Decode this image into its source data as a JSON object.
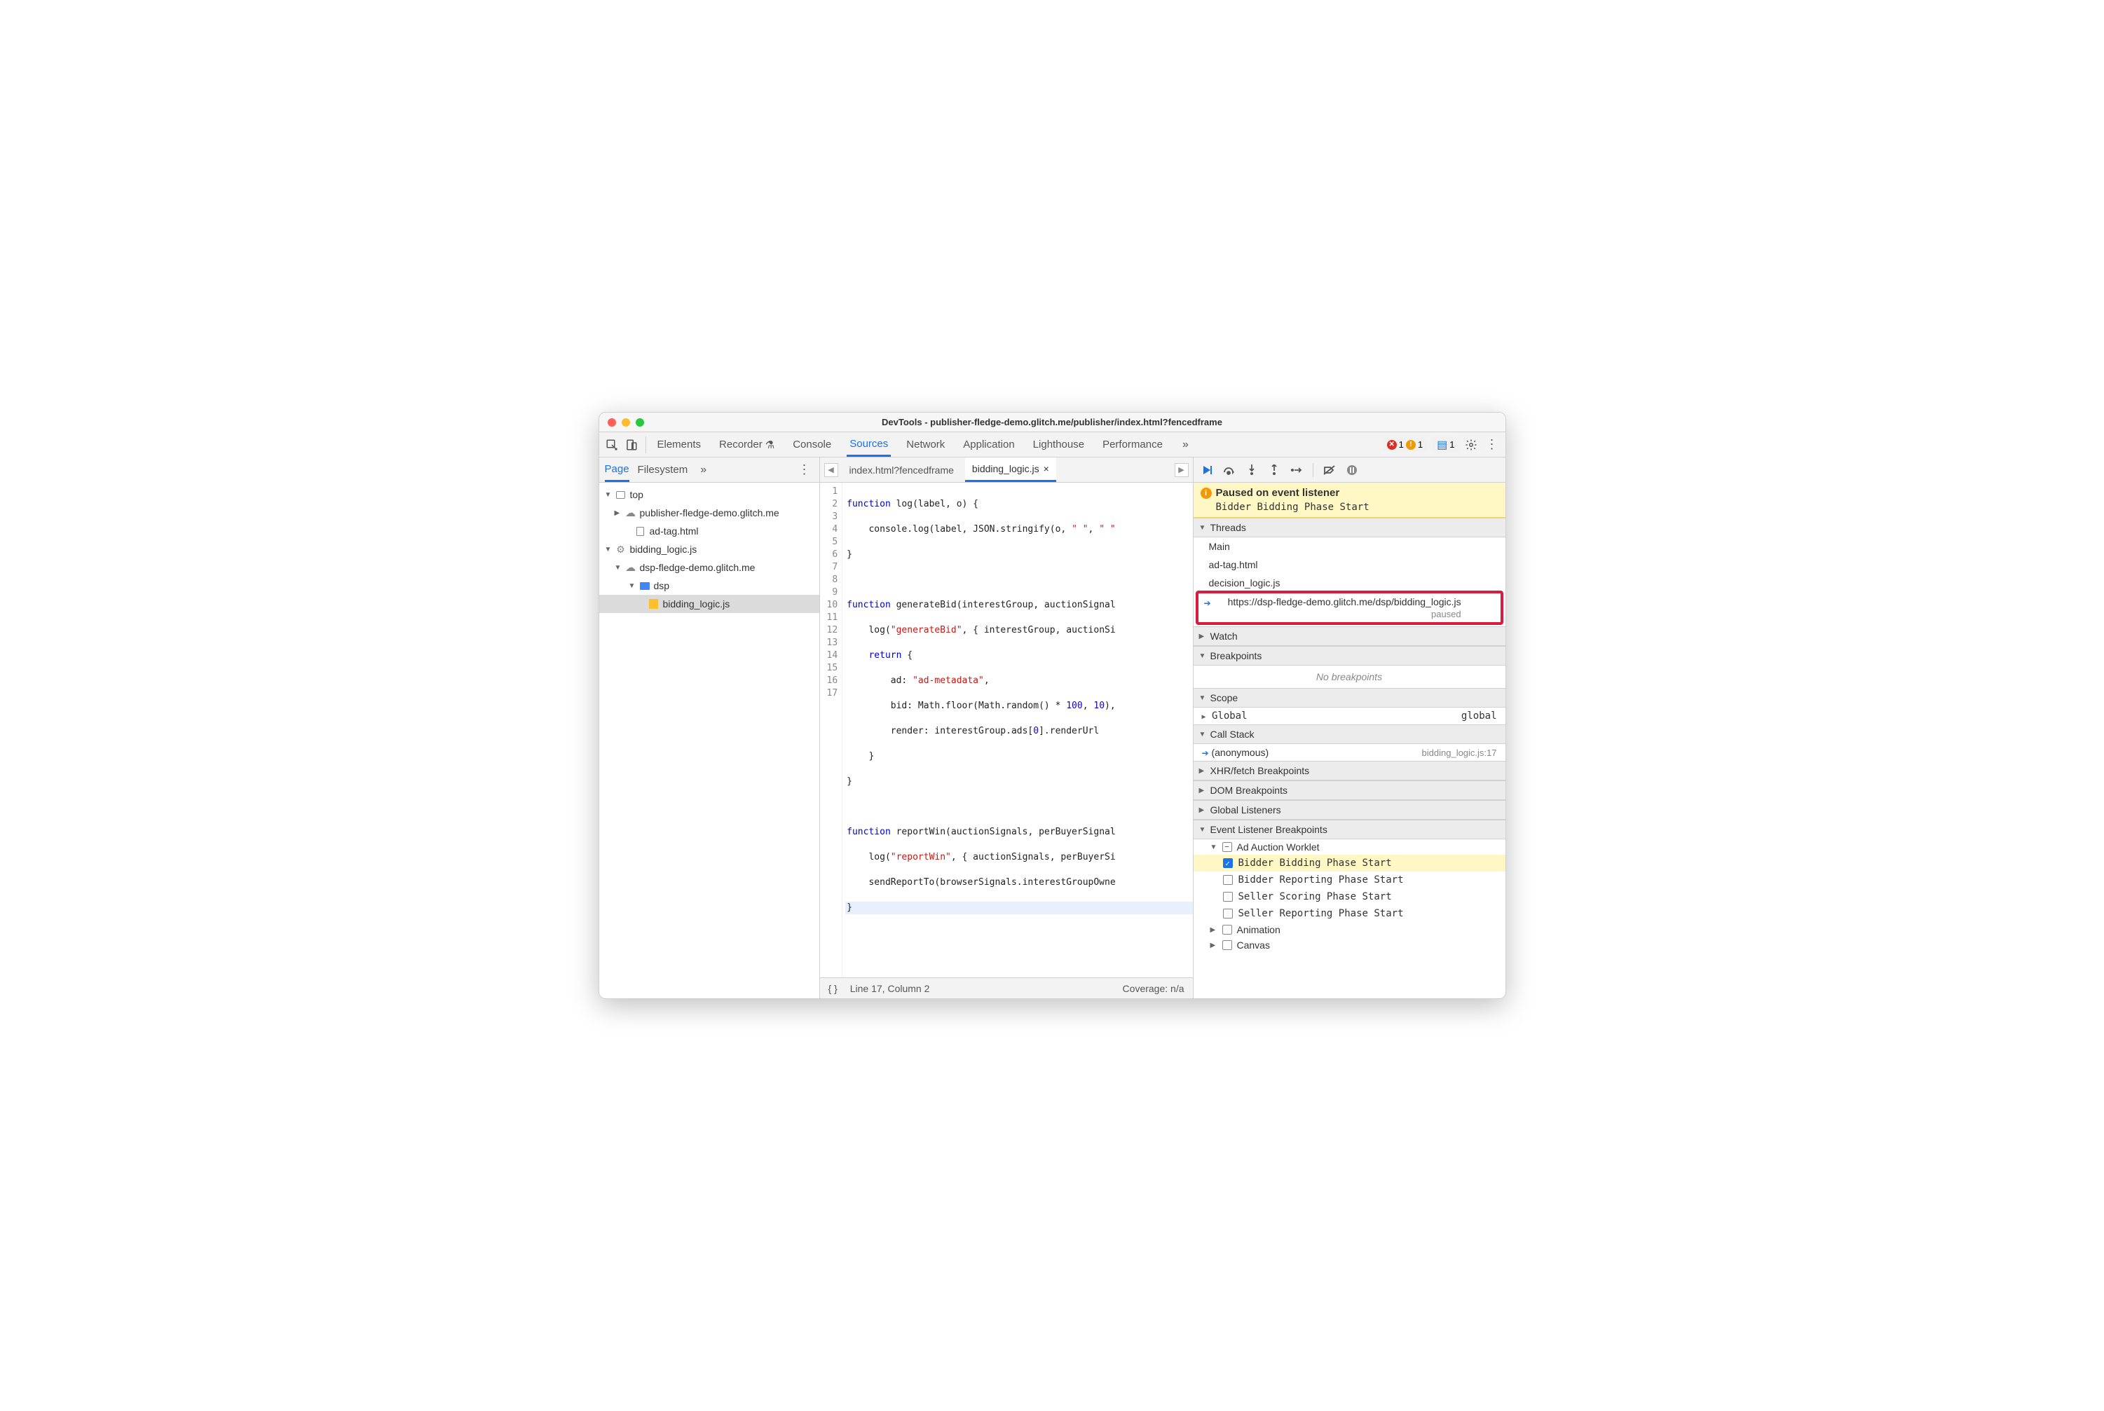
{
  "window": {
    "title": "DevTools - publisher-fledge-demo.glitch.me/publisher/index.html?fencedframe"
  },
  "mainTabs": {
    "items": [
      "Elements",
      "Recorder",
      "Console",
      "Sources",
      "Network",
      "Application",
      "Lighthouse",
      "Performance"
    ],
    "active": "Sources",
    "errors": "1",
    "warnings": "1",
    "messages": "1"
  },
  "leftPanel": {
    "tabs": {
      "page": "Page",
      "filesystem": "Filesystem"
    },
    "tree": {
      "top": "top",
      "pub": "publisher-fledge-demo.glitch.me",
      "adtag": "ad-tag.html",
      "bidlogic": "bidding_logic.js",
      "dsp": "dsp-fledge-demo.glitch.me",
      "dspfolder": "dsp",
      "bidfile": "bidding_logic.js"
    }
  },
  "fileTabs": {
    "tab1": "index.html?fencedframe",
    "tab2": "bidding_logic.js"
  },
  "code": {
    "l1a": "function",
    "l1b": " log(label, o) {",
    "l2a": "    console.log(label, JSON.stringify(o, ",
    "l2b": "\" \"",
    "l2c": ", ",
    "l2d": "\" \"",
    "l3": "}",
    "l5a": "function",
    "l5b": " generateBid(interestGroup, auctionSignal",
    "l6a": "    log(",
    "l6b": "\"generateBid\"",
    "l6c": ", { interestGroup, auctionSi",
    "l7a": "    ",
    "l7b": "return",
    "l7c": " {",
    "l8a": "        ad: ",
    "l8b": "\"ad-metadata\"",
    "l8c": ",",
    "l9a": "        bid: Math.floor(Math.random() * ",
    "l9b": "100",
    "l9c": ", ",
    "l9d": "10",
    "l9e": "),",
    "l10a": "        render: interestGroup.ads[",
    "l10b": "0",
    "l10c": "].renderUrl",
    "l11": "    }",
    "l12": "}",
    "l14a": "function",
    "l14b": " reportWin(auctionSignals, perBuyerSignal",
    "l15a": "    log(",
    "l15b": "\"reportWin\"",
    "l15c": ", { auctionSignals, perBuyerSi",
    "l16": "    sendReportTo(browserSignals.interestGroupOwne",
    "l17": "}"
  },
  "statusbar": {
    "pos": "Line 17, Column 2",
    "coverage": "Coverage: n/a"
  },
  "debugger": {
    "pausedTitle": "Paused on event listener",
    "pausedSub": "Bidder Bidding Phase Start",
    "sections": {
      "threads": "Threads",
      "watch": "Watch",
      "breakpoints": "Breakpoints",
      "scope": "Scope",
      "callstack": "Call Stack",
      "xhr": "XHR/fetch Breakpoints",
      "dom": "DOM Breakpoints",
      "global": "Global Listeners",
      "elb": "Event Listener Breakpoints"
    },
    "threads": {
      "main": "Main",
      "adtag": "ad-tag.html",
      "decision": "decision_logic.js",
      "active": "https://dsp-fledge-demo.glitch.me/dsp/bidding_logic.js",
      "paused": "paused"
    },
    "noBreakpoints": "No breakpoints",
    "scope": {
      "global": "Global",
      "globalVal": "global"
    },
    "callstack": {
      "anon": "(anonymous)",
      "loc": "bidding_logic.js:17"
    },
    "elb": {
      "adAuction": "Ad Auction Worklet",
      "bidderBidding": "Bidder Bidding Phase Start",
      "bidderReporting": "Bidder Reporting Phase Start",
      "sellerScoring": "Seller Scoring Phase Start",
      "sellerReporting": "Seller Reporting Phase Start",
      "animation": "Animation",
      "canvas": "Canvas"
    }
  }
}
